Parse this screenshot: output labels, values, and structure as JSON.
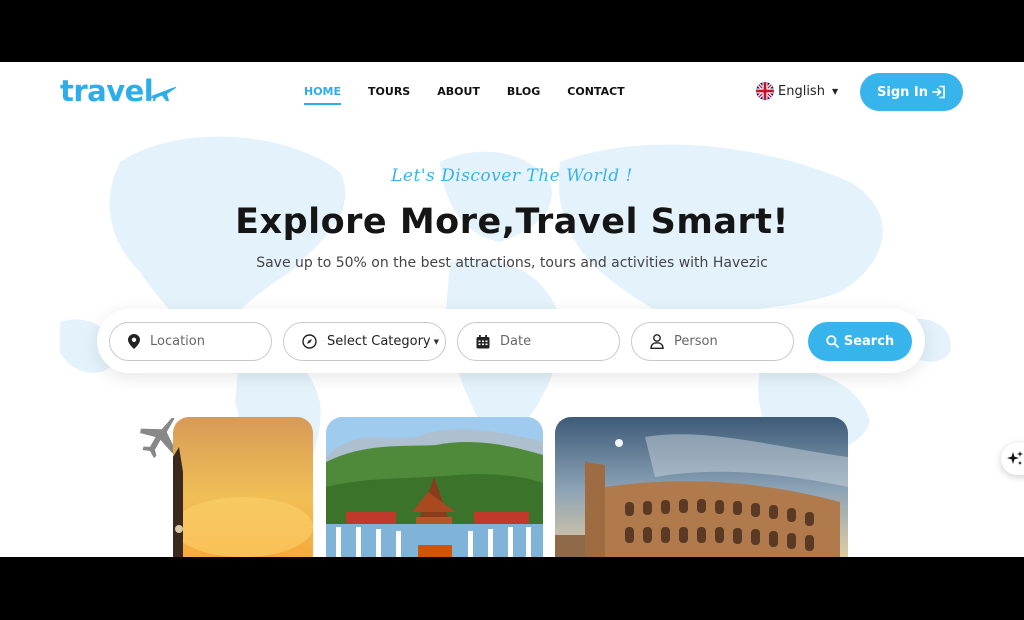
{
  "brand": {
    "logo_text": "travel",
    "accent_color": "#38b4ec"
  },
  "nav": {
    "items": [
      {
        "label": "HOME",
        "active": true
      },
      {
        "label": "TOURS",
        "active": false
      },
      {
        "label": "ABOUT",
        "active": false
      },
      {
        "label": "BLOG",
        "active": false
      },
      {
        "label": "CONTACT",
        "active": false
      }
    ]
  },
  "language": {
    "label": "English",
    "flag_icon": "uk-flag-icon"
  },
  "signin": {
    "label": "Sign In",
    "icon": "sign-in-icon"
  },
  "hero": {
    "tagline": "Let's Discover The World !",
    "headline": "Explore More,Travel Smart!",
    "subline": "Save up to 50% on the best attractions, tours and activities with Havezic"
  },
  "search": {
    "location_placeholder": "Location",
    "category_label": "Select Category",
    "date_placeholder": "Date",
    "person_placeholder": "Person",
    "button_label": "Search"
  },
  "cards": [
    {
      "image": "london-big-ben-sunset"
    },
    {
      "image": "thai-temple-mountain"
    },
    {
      "image": "rome-colosseum"
    }
  ]
}
